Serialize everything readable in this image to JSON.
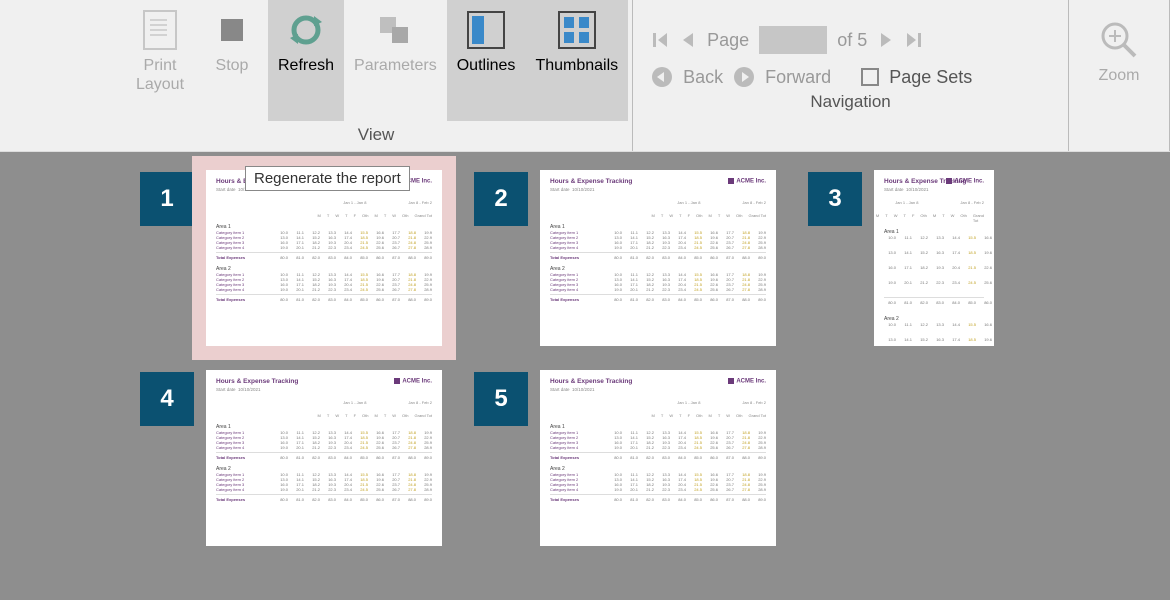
{
  "ribbon": {
    "print_layout": "Print\nLayout",
    "stop": "Stop",
    "refresh": "Refresh",
    "parameters": "Parameters",
    "outlines": "Outlines",
    "thumbnails": "Thumbnails",
    "zoom": "Zoom",
    "group_view": "View",
    "group_nav": "Navigation"
  },
  "nav": {
    "page_label": "Page",
    "page_total": "of 5",
    "back": "Back",
    "forward": "Forward",
    "page_sets": "Page Sets"
  },
  "tooltip": "Regenerate the report",
  "pages": {
    "count": 5,
    "selected": 1,
    "thumb": {
      "title": "Hours & Expense Tracking",
      "logo": "ACME Inc.",
      "date_label": "Start date",
      "date_value": "10/10/2021"
    }
  }
}
